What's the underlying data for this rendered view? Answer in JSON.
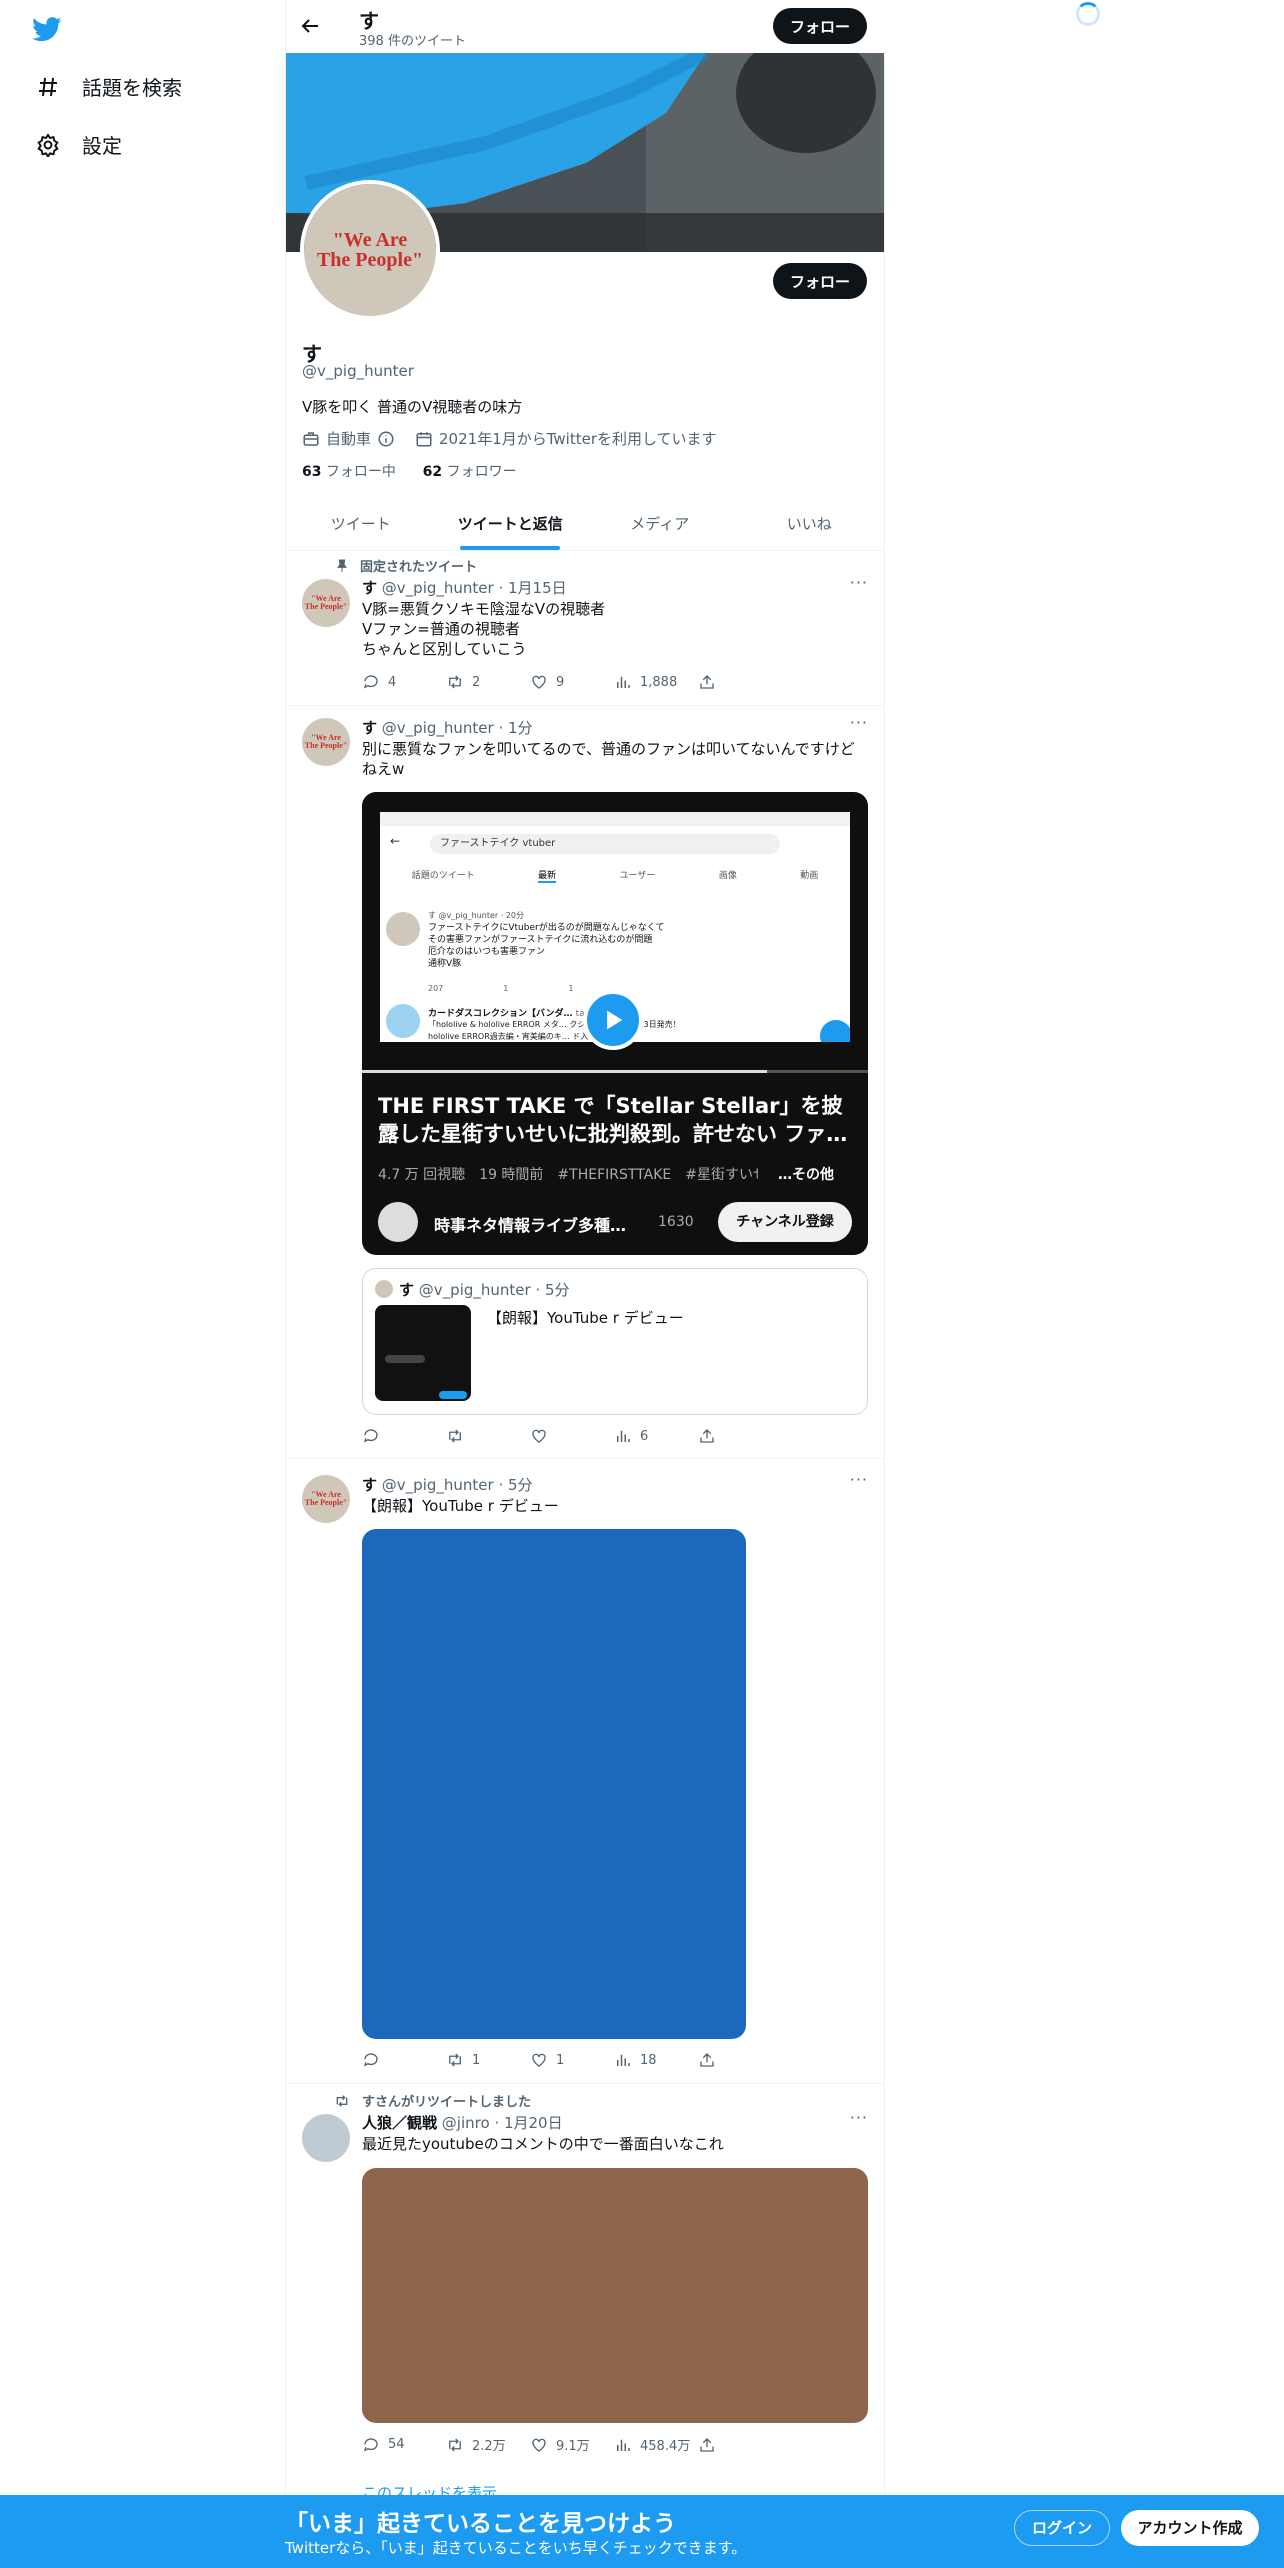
{
  "sidebar": {
    "explore": "話題を検索",
    "settings": "設定"
  },
  "topbar": {
    "name": "す",
    "tweet_count": "398 件のツイート",
    "follow": "フォロー"
  },
  "profile": {
    "avatar_text_1": "\"We Are",
    "avatar_text_2": "The People\"",
    "follow": "フォロー",
    "name": "す",
    "handle": "@v_pig_hunter",
    "bio": "V豚を叩く 普通のV視聴者の味方",
    "category": "自動車",
    "joined": "2021年1月からTwitterを利用しています",
    "following_count": "63",
    "following_label": " フォロー中",
    "followers_count": "62",
    "followers_label": " フォロワー"
  },
  "tabs": [
    {
      "label": "ツイート"
    },
    {
      "label": "ツイートと返信"
    },
    {
      "label": "メディア"
    },
    {
      "label": "いいね"
    }
  ],
  "pinned_label": "固定されたツイート",
  "tweets": [
    {
      "name": "す",
      "handle": "@v_pig_hunter",
      "time": "· 1月15日",
      "lines": [
        "V豚=悪質クソキモ陰湿なVの視聴者",
        "Vファン=普通の視聴者",
        "ちゃんと区別していこう"
      ],
      "reply": "4",
      "retweet": "2",
      "like": "9",
      "views": "1,888"
    },
    {
      "name": "す",
      "handle": "@v_pig_hunter",
      "time": "· 1分",
      "lines": [
        "別に悪質なファンを叩いてるので、普通のファンは叩いてないんですけど",
        "ねえw"
      ],
      "reply": "",
      "retweet": "",
      "like": "",
      "views": "6"
    },
    {
      "name": "す",
      "handle": "@v_pig_hunter",
      "time": "· 5分",
      "lines": [
        "【朗報】YouTube r デビュー"
      ],
      "reply": "",
      "retweet": "1",
      "like": "1",
      "views": "18"
    },
    {
      "name": "人狼／観戦",
      "handle": "@jinro",
      "time": "· 1月20日",
      "lines": [
        "最近見たyoutubeのコメントの中で一番面白いなこれ"
      ],
      "reply": "54",
      "retweet": "2.2万",
      "like": "9.1万",
      "views": "458.4万"
    }
  ],
  "video": {
    "screen_search": "ファーストテイク vtuber",
    "screen_tabs": [
      "話題のツイート",
      "最新",
      "ユーザー",
      "画像",
      "動画"
    ],
    "screen_tweet_handle": "す @v_pig_hunter · 20分",
    "screen_tweet_lines": [
      "ファーストテイクにVtuberが出るのが問題なんじゃなくて",
      "その害悪ファンがファーストテイクに流れ込むのが問題",
      "厄介なのはいつも害悪ファン",
      "通称V豚"
    ],
    "screen_tweet_stats": [
      "207",
      "1",
      "1"
    ],
    "screen_tweet2_name": "カードダスコレクション【バンダ…",
    "screen_tweet2_handle": "tai_carddass",
    "screen_tweet2_line1": "「hololive & hololive ERROR メタ… クション」本日1月13日発売！",
    "screen_tweet2_line2": "hololive ERROR過去編・宵美編のキ… ド入",
    "title": "THE FIRST TAKE で「Stellar Stellar」を披露した星街すいせいに批判殺到。許せない ファ…",
    "meta": "4.7 万 回視聴　19 時間前　#THEFIRSTTAKE　#星街すいせ",
    "meta_more": "…その他",
    "channel": "時事ネタ情報ライブ多種…",
    "subs": "1630",
    "subscribe": "チャンネル登録"
  },
  "quote": {
    "name": "す",
    "handle": "@v_pig_hunter",
    "time": "· 5分",
    "text": "【朗報】YouTube r デビュー"
  },
  "retweeted_by": "すさんがリツイートしました",
  "show_thread": "このスレッドを表示",
  "bottom": {
    "title": "「いま」起きていることを見つけよう",
    "subtitle": "Twitterなら、「いま」起きていることをいち早くチェックできます。",
    "login": "ログイン",
    "signup": "アカウント作成"
  }
}
